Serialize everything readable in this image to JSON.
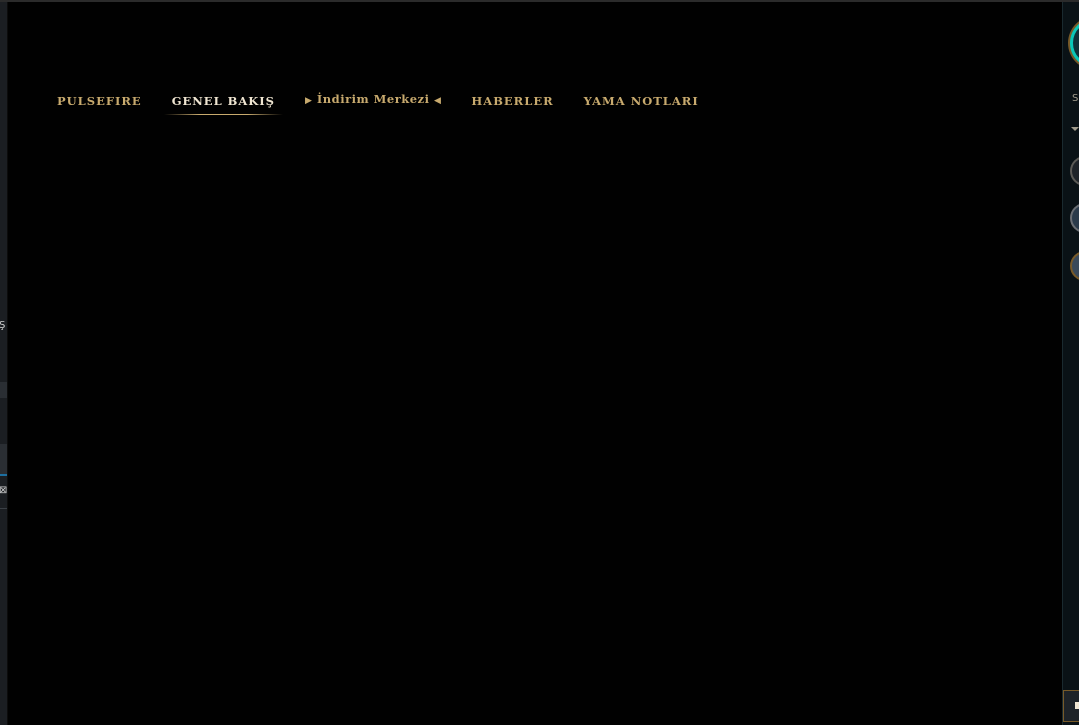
{
  "nav": {
    "items": [
      {
        "label": "PULSEFIRE",
        "active": false
      },
      {
        "label": "GENEL BAKIŞ",
        "active": true
      },
      {
        "label": "İndirim Merkezi",
        "active": false,
        "arrow_left": "▶",
        "arrow_right": "◀"
      },
      {
        "label": "HABERLER",
        "active": false
      },
      {
        "label": "YAMA NOTLARI",
        "active": false
      }
    ]
  },
  "left_strip": {
    "glyph_top": "Ş",
    "glyph_bottom": "⊠"
  },
  "sidebar": {
    "status_letter": "S"
  },
  "colors": {
    "gold": "#c8aa6e",
    "gold_light": "#f0e6d2",
    "background": "#010101",
    "teal": "#0ac8b9"
  }
}
